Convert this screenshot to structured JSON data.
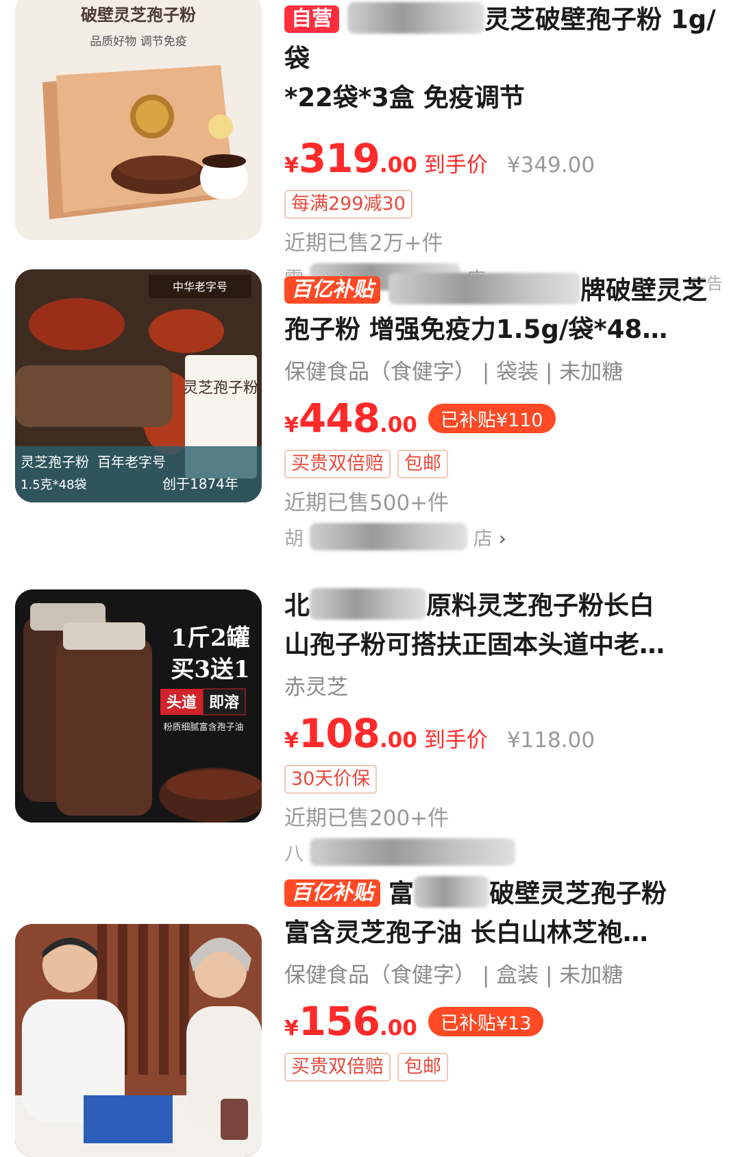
{
  "items": [
    {
      "badge": "自营",
      "title_a": "灵芝破壁孢子粉 1g/袋",
      "title_b": "*22袋*3盒 免疫调节",
      "price": {
        "yen": "¥",
        "amount": "319",
        "decimals": ".00",
        "net_label": "到手价",
        "original": "¥349.00"
      },
      "tags": [
        "每满299减30"
      ],
      "sold": "近期已售2万+件",
      "shop_prefix": "雷",
      "shop_suffix": "店",
      "chevron": "›",
      "ad": "广告",
      "image": {
        "title": "破壁灵芝孢子粉",
        "subtitle": "品质好物 调节免疫"
      }
    },
    {
      "badge": "百亿补贴",
      "title_a": "牌破壁灵芝",
      "title_b": "孢子粉 增强免疫力1.5g/袋*48…",
      "attrs": "保健食品（食健字） | 袋装 | 未加糖",
      "price": {
        "yen": "¥",
        "amount": "448",
        "decimals": ".00",
        "subsidy": "已补贴¥110"
      },
      "tags": [
        "买贵双倍赔",
        "包邮"
      ],
      "sold": "近期已售500+件",
      "shop_prefix": "胡",
      "shop_suffix": "店",
      "chevron": "›",
      "image": {
        "brand": "中华老字号",
        "label_a": "灵芝孢子粉",
        "label_b": "1.5克*48袋",
        "label_c": "百年老字号",
        "label_d": "创于1874年",
        "pack": "灵芝孢子粉"
      }
    },
    {
      "title_a": "原料灵芝孢子粉长白",
      "title_prefix": "北",
      "title_b": "山孢子粉可搭扶正固本头道中老…",
      "attrs": "赤灵芝",
      "price": {
        "yen": "¥",
        "amount": "108",
        "decimals": ".00",
        "net_label": "到手价",
        "original": "¥118.00"
      },
      "tags": [
        "30天价保"
      ],
      "sold": "近期已售200+件",
      "shop_prefix": "八",
      "image": {
        "line1": "1斤2罐",
        "line2": "买3送1",
        "tag_a": "头道",
        "tag_b": "即溶",
        "line3": "粉质细腻富含孢子油"
      }
    },
    {
      "badge": "百亿补贴",
      "title_a": "破壁灵芝孢子粉",
      "title_prefix": "富",
      "title_b": "富含灵芝孢子油 长白山林芝袍…",
      "attrs": "保健食品（食健字） | 盒装 | 未加糖",
      "price": {
        "yen": "¥",
        "amount": "156",
        "decimals": ".00",
        "subsidy": "已补贴¥13"
      },
      "tags": [
        "买贵双倍赔",
        "包邮"
      ]
    }
  ]
}
